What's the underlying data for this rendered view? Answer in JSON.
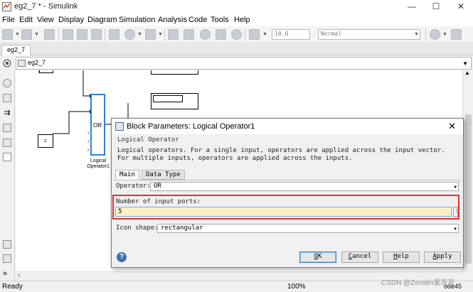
{
  "window": {
    "title": "eg2_7 * - Simulink",
    "minimize": "—",
    "maximize": "☐",
    "close": "✕"
  },
  "menu": [
    "File",
    "Edit",
    "View",
    "Display",
    "Diagram",
    "Simulation",
    "Analysis",
    "Code",
    "Tools",
    "Help"
  ],
  "toolbar": {
    "stop_time": "10.0",
    "sim_mode": "Normal"
  },
  "tab": "eg2_7",
  "breadcrumb": "eg2_7",
  "canvas": {
    "constant_label": "c",
    "logic_block_text": "OR",
    "logic_block_name_line1": "Logical",
    "logic_block_name_line2": "Operator1"
  },
  "dialog": {
    "title": "Block Parameters: Logical Operator1",
    "group_title": "Logical Operator",
    "description": "Logical operators.  For a single input, operators are applied across the input vector.  For multiple inputs, operators are applied across the inputs.",
    "tabs": [
      "Main",
      "Data Type"
    ],
    "operator_label": "Operator:",
    "operator_value": "OR",
    "ports_label": "Number of input ports:",
    "ports_value": "5",
    "shape_label": "Icon shape:",
    "shape_value": "rectangular",
    "buttons": {
      "ok_u": "O",
      "ok_rest": "K",
      "cancel_u": "C",
      "cancel_rest": "ancel",
      "help_u": "H",
      "help_rest": "elp",
      "apply_u": "A",
      "apply_rest": "pply"
    }
  },
  "status": {
    "left": "Ready",
    "zoom": "100%",
    "solver": "ode45"
  },
  "watermark": "CSDN @Zevalin爱灰灰",
  "colors": {
    "highlight_border": "#e0322a",
    "port_input_bg": "#fbf0c8",
    "selected_block": "#2f7fd6"
  }
}
